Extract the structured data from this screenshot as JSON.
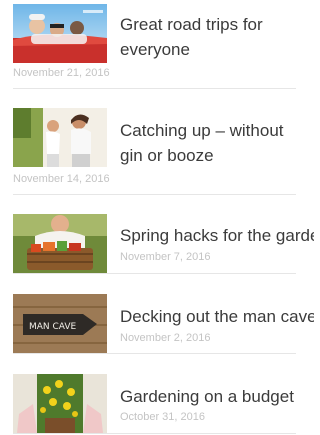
{
  "posts": [
    {
      "title": "Great road trips for everyone",
      "date": "November 21, 2016",
      "thumb_icon": "convertible-car-family-photo"
    },
    {
      "title": "Catching up – without gin or booze",
      "date": "November 14, 2016",
      "thumb_icon": "women-jogging-photo"
    },
    {
      "title": "Spring hacks for the garden",
      "date": "November 7, 2016",
      "thumb_icon": "vegetable-basket-photo"
    },
    {
      "title": "Decking out the man cave",
      "date": "November 2, 2016",
      "thumb_icon": "man-cave-sign-photo",
      "thumb_text": "MAN CAVE"
    },
    {
      "title": "Gardening on a budget",
      "date": "October 31, 2016",
      "thumb_icon": "yellow-flowers-pot-photo"
    }
  ],
  "colors": {
    "title": "#3b3b3b",
    "date": "#c4c4c4",
    "divider": "#e6e6e6"
  }
}
